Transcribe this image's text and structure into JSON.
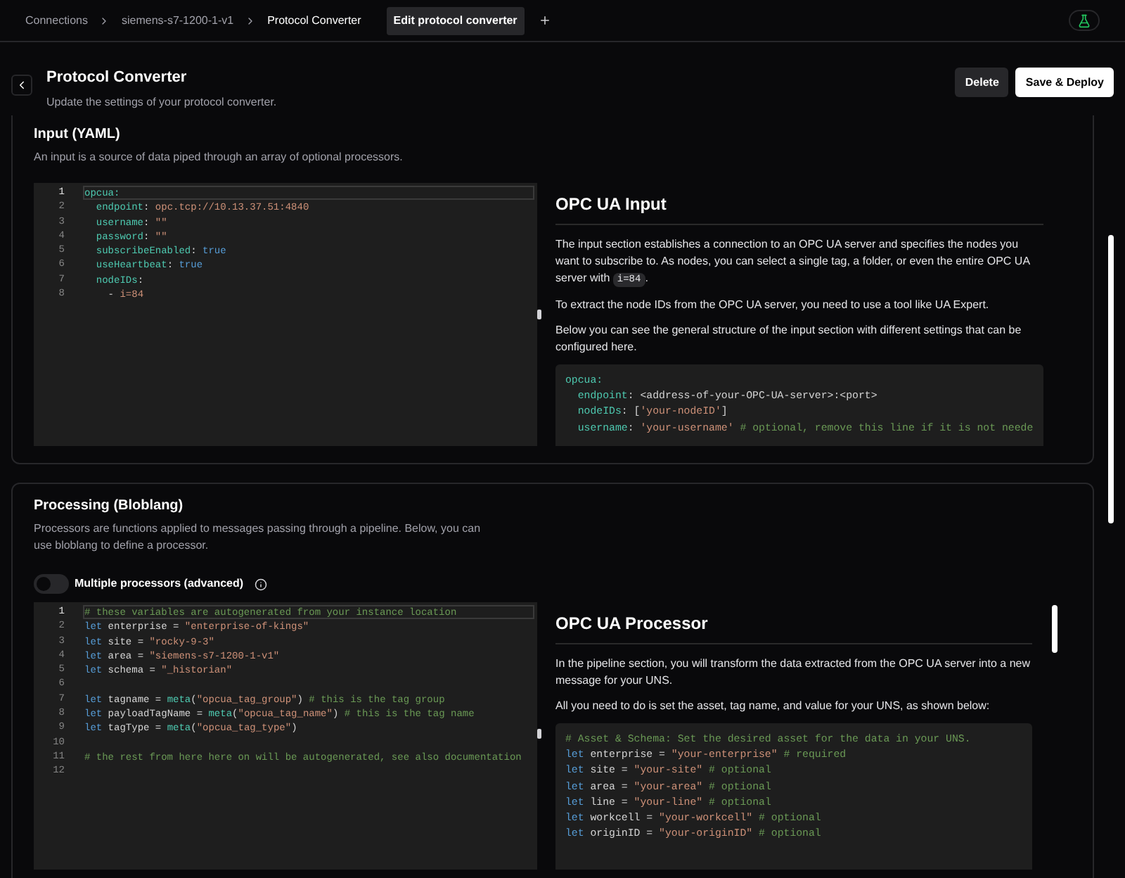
{
  "breadcrumbs": [
    {
      "label": "Connections",
      "current": false
    },
    {
      "label": "siemens-s7-1200-1-v1",
      "current": false
    },
    {
      "label": "Protocol Converter",
      "current": true
    }
  ],
  "tabs": [
    {
      "label": "Edit protocol converter",
      "selected": true
    }
  ],
  "header": {
    "title": "Protocol Converter",
    "subtitle": "Update the settings of your protocol converter."
  },
  "buttons": [
    {
      "label": "Delete",
      "kind": "secondary"
    },
    {
      "label": "Save & Deploy",
      "kind": "primary"
    }
  ],
  "sections": [
    {
      "title": "Input (YAML)",
      "description": "An input is a source of data piped through an array of optional processors.",
      "editor": {
        "lines": [
          {
            "number": "1",
            "active": true,
            "tokens": [
              {
                "kind": "key",
                "text": "opcua:"
              }
            ]
          },
          {
            "number": "2",
            "active": false,
            "tokens": [
              {
                "kind": "key",
                "text": "  endpoint"
              },
              {
                "kind": "plain",
                "text": ": "
              },
              {
                "kind": "string",
                "text": "opc.tcp://10.13.37.51:4840"
              }
            ]
          },
          {
            "number": "3",
            "active": false,
            "tokens": [
              {
                "kind": "key",
                "text": "  username"
              },
              {
                "kind": "plain",
                "text": ": "
              },
              {
                "kind": "string",
                "text": "\"\""
              }
            ]
          },
          {
            "number": "4",
            "active": false,
            "tokens": [
              {
                "kind": "key",
                "text": "  password"
              },
              {
                "kind": "plain",
                "text": ": "
              },
              {
                "kind": "string",
                "text": "\"\""
              }
            ]
          },
          {
            "number": "5",
            "active": false,
            "tokens": [
              {
                "kind": "key",
                "text": "  subscribeEnabled"
              },
              {
                "kind": "plain",
                "text": ": "
              },
              {
                "kind": "keyword",
                "text": "true"
              }
            ]
          },
          {
            "number": "6",
            "active": false,
            "tokens": [
              {
                "kind": "key",
                "text": "  useHeartbeat"
              },
              {
                "kind": "plain",
                "text": ": "
              },
              {
                "kind": "keyword",
                "text": "true"
              }
            ]
          },
          {
            "number": "7",
            "active": false,
            "tokens": [
              {
                "kind": "key",
                "text": "  nodeIDs"
              },
              {
                "kind": "plain",
                "text": ":"
              }
            ]
          },
          {
            "number": "8",
            "active": false,
            "tokens": [
              {
                "kind": "plain",
                "text": "    - "
              },
              {
                "kind": "string",
                "text": "i=84"
              }
            ]
          }
        ]
      },
      "docs": {
        "title": "OPC UA Input",
        "paragraphs": [
          [
            {
              "text": "The input section establishes a connection to an OPC UA server and specifies the nodes you want to subscribe to. As nodes, you can select a single tag, a folder, or even the entire OPC UA server with "
            },
            {
              "code": "i=84"
            },
            {
              "text": "."
            }
          ],
          [
            {
              "text": "To extract the node IDs from the OPC UA server, you need to use a tool like UA Expert."
            }
          ],
          [
            {
              "text": "Below you can see the general structure of the input section with different settings that can be configured here."
            }
          ]
        ],
        "code_lines": [
          {
            "tokens": [
              {
                "kind": "key",
                "text": "opcua:"
              }
            ]
          },
          {
            "tokens": [
              {
                "kind": "key",
                "text": "  endpoint"
              },
              {
                "kind": "plain",
                "text": ": <address-of-your-OPC-UA-server>:<port>"
              }
            ]
          },
          {
            "tokens": [
              {
                "kind": "key",
                "text": "  nodeIDs"
              },
              {
                "kind": "plain",
                "text": ": ["
              },
              {
                "kind": "string",
                "text": "'your-nodeID'"
              },
              {
                "kind": "plain",
                "text": "]"
              }
            ]
          },
          {
            "tokens": [
              {
                "kind": "key",
                "text": "  username"
              },
              {
                "kind": "plain",
                "text": ": "
              },
              {
                "kind": "string",
                "text": "'your-username'"
              },
              {
                "kind": "comment",
                "text": " # optional, remove this line if it is not neede"
              }
            ]
          }
        ]
      }
    },
    {
      "title": "Processing (Bloblang)",
      "description": "Processors are functions applied to messages passing through a pipeline. Below, you can use bloblang to define a processor.",
      "toggle": {
        "label": "Multiple processors (advanced)",
        "on": false
      },
      "editor": {
        "lines": [
          {
            "number": "1",
            "active": true,
            "tokens": [
              {
                "kind": "comment",
                "text": "# these variables are autogenerated from your instance location"
              }
            ]
          },
          {
            "number": "2",
            "active": false,
            "tokens": [
              {
                "kind": "keyword",
                "text": "let"
              },
              {
                "kind": "plain",
                "text": " enterprise = "
              },
              {
                "kind": "string",
                "text": "\"enterprise-of-kings\""
              }
            ]
          },
          {
            "number": "3",
            "active": false,
            "tokens": [
              {
                "kind": "keyword",
                "text": "let"
              },
              {
                "kind": "plain",
                "text": " site = "
              },
              {
                "kind": "string",
                "text": "\"rocky-9-3\""
              }
            ]
          },
          {
            "number": "4",
            "active": false,
            "tokens": [
              {
                "kind": "keyword",
                "text": "let"
              },
              {
                "kind": "plain",
                "text": " area = "
              },
              {
                "kind": "string",
                "text": "\"siemens-s7-1200-1-v1\""
              }
            ]
          },
          {
            "number": "5",
            "active": false,
            "tokens": [
              {
                "kind": "keyword",
                "text": "let"
              },
              {
                "kind": "plain",
                "text": " schema = "
              },
              {
                "kind": "string",
                "text": "\"_historian\""
              }
            ]
          },
          {
            "number": "6",
            "active": false
          },
          {
            "number": "7",
            "active": false,
            "tokens": [
              {
                "kind": "keyword",
                "text": "let"
              },
              {
                "kind": "plain",
                "text": " tagname = "
              },
              {
                "kind": "func",
                "text": "meta"
              },
              {
                "kind": "plain",
                "text": "("
              },
              {
                "kind": "string",
                "text": "\"opcua_tag_group\""
              },
              {
                "kind": "plain",
                "text": ") "
              },
              {
                "kind": "comment",
                "text": "# this is the tag group"
              }
            ]
          },
          {
            "number": "8",
            "active": false,
            "tokens": [
              {
                "kind": "keyword",
                "text": "let"
              },
              {
                "kind": "plain",
                "text": " payloadTagName = "
              },
              {
                "kind": "func",
                "text": "meta"
              },
              {
                "kind": "plain",
                "text": "("
              },
              {
                "kind": "string",
                "text": "\"opcua_tag_name\""
              },
              {
                "kind": "plain",
                "text": ") "
              },
              {
                "kind": "comment",
                "text": "# this is the tag name"
              }
            ]
          },
          {
            "number": "9",
            "active": false,
            "tokens": [
              {
                "kind": "keyword",
                "text": "let"
              },
              {
                "kind": "plain",
                "text": " tagType = "
              },
              {
                "kind": "func",
                "text": "meta"
              },
              {
                "kind": "plain",
                "text": "("
              },
              {
                "kind": "string",
                "text": "\"opcua_tag_type\""
              },
              {
                "kind": "plain",
                "text": ")"
              }
            ]
          },
          {
            "number": "10",
            "active": false
          },
          {
            "number": "11",
            "active": false,
            "tokens": [
              {
                "kind": "comment",
                "text": "# the rest from here here on will be autogenerated, see also documentation"
              }
            ]
          },
          {
            "number": "12",
            "active": false
          }
        ]
      },
      "docs": {
        "title": "OPC UA Processor",
        "paragraphs": [
          [
            {
              "text": "In the pipeline section, you will transform the data extracted from the OPC UA server into a new message for your UNS."
            }
          ],
          [
            {
              "text": "All you need to do is set the asset, tag name, and value for your UNS, as shown below:"
            }
          ]
        ],
        "code_lines": [
          {
            "tokens": [
              {
                "kind": "comment",
                "text": "# Asset & Schema: Set the desired asset for the data in your UNS."
              }
            ]
          },
          {
            "tokens": [
              {
                "kind": "keyword",
                "text": "let"
              },
              {
                "kind": "plain",
                "text": " enterprise = "
              },
              {
                "kind": "string",
                "text": "\"your-enterprise\""
              },
              {
                "kind": "comment",
                "text": " # required"
              }
            ]
          },
          {
            "tokens": [
              {
                "kind": "keyword",
                "text": "let"
              },
              {
                "kind": "plain",
                "text": " site = "
              },
              {
                "kind": "string",
                "text": "\"your-site\""
              },
              {
                "kind": "comment",
                "text": " # optional"
              }
            ]
          },
          {
            "tokens": [
              {
                "kind": "keyword",
                "text": "let"
              },
              {
                "kind": "plain",
                "text": " area = "
              },
              {
                "kind": "string",
                "text": "\"your-area\""
              },
              {
                "kind": "comment",
                "text": " # optional"
              }
            ]
          },
          {
            "tokens": [
              {
                "kind": "keyword",
                "text": "let"
              },
              {
                "kind": "plain",
                "text": " line = "
              },
              {
                "kind": "string",
                "text": "\"your-line\""
              },
              {
                "kind": "comment",
                "text": " # optional"
              }
            ]
          },
          {
            "tokens": [
              {
                "kind": "keyword",
                "text": "let"
              },
              {
                "kind": "plain",
                "text": " workcell = "
              },
              {
                "kind": "string",
                "text": "\"your-workcell\""
              },
              {
                "kind": "comment",
                "text": " # optional"
              }
            ]
          },
          {
            "tokens": [
              {
                "kind": "keyword",
                "text": "let"
              },
              {
                "kind": "plain",
                "text": " originID = "
              },
              {
                "kind": "string",
                "text": "\"your-originID\""
              },
              {
                "kind": "comment",
                "text": " # optional"
              }
            ]
          }
        ]
      }
    }
  ]
}
